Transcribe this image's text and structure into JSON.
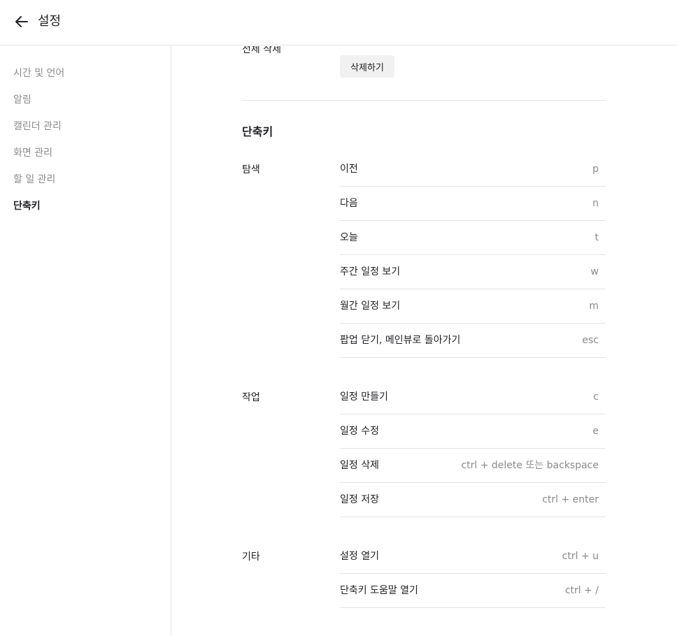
{
  "header": {
    "back_icon": "arrow-left-icon",
    "title": "설정"
  },
  "sidebar": {
    "items": [
      {
        "label": "시간 및 언어",
        "active": false
      },
      {
        "label": "알림",
        "active": false
      },
      {
        "label": "캘린더 관리",
        "active": false
      },
      {
        "label": "화면 관리",
        "active": false
      },
      {
        "label": "할 일 관리",
        "active": false
      },
      {
        "label": "단축키",
        "active": true
      }
    ]
  },
  "main": {
    "delete_all": {
      "label": "전체 삭제",
      "button_label": "삭제하기"
    },
    "shortcuts": {
      "title": "단축키",
      "groups": [
        {
          "label": "탐색",
          "rows": [
            {
              "label": "이전",
              "key": "p"
            },
            {
              "label": "다음",
              "key": "n"
            },
            {
              "label": "오늘",
              "key": "t"
            },
            {
              "label": "주간 일정 보기",
              "key": "w"
            },
            {
              "label": "월간 일정 보기",
              "key": "m"
            },
            {
              "label": "팝업 닫기, 메인뷰로 돌아가기",
              "key": "esc"
            }
          ]
        },
        {
          "label": "작업",
          "rows": [
            {
              "label": "일정 만들기",
              "key": "c"
            },
            {
              "label": "일정 수정",
              "key": "e"
            },
            {
              "label": "일정 삭제",
              "key": "ctrl + delete 또는 backspace"
            },
            {
              "label": "일정 저장",
              "key": "ctrl + enter"
            }
          ]
        },
        {
          "label": "기타",
          "rows": [
            {
              "label": "설정 열기",
              "key": "ctrl + u"
            },
            {
              "label": "단축키 도움말 열기",
              "key": "ctrl + /"
            }
          ]
        }
      ]
    }
  }
}
